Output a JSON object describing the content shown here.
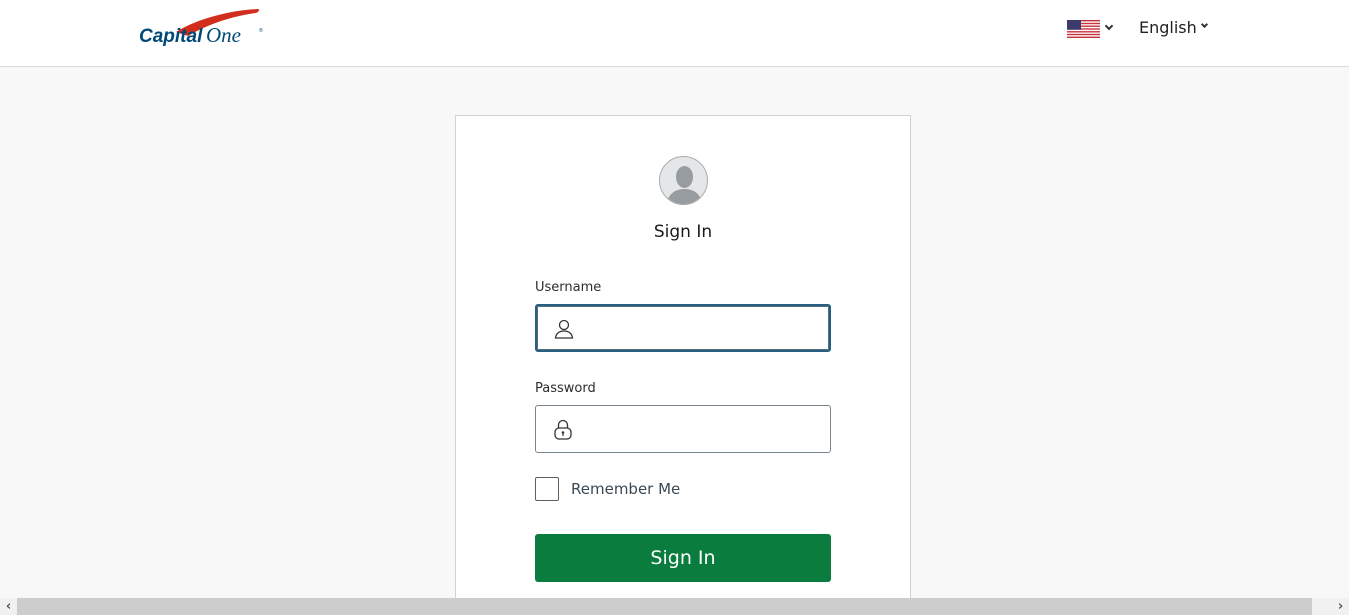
{
  "header": {
    "logo_text": "Capital One",
    "country_selector": {
      "selected": "United States",
      "icon": "us-flag-icon"
    },
    "language_selector": {
      "selected": "English"
    }
  },
  "signin_card": {
    "avatar_icon": "user-avatar-icon",
    "title": "Sign In",
    "username": {
      "label": "Username",
      "value": "",
      "placeholder": "",
      "icon": "user-icon"
    },
    "password": {
      "label": "Password",
      "value": "",
      "placeholder": "",
      "icon": "lock-icon"
    },
    "remember_me": {
      "label": "Remember Me",
      "checked": false
    },
    "submit_label": "Sign In"
  },
  "scrollbar": {
    "left_arrow": "‹",
    "right_arrow": "›"
  },
  "colors": {
    "primary_button": "#0a7c3e",
    "focus_border": "#255f82",
    "logo_red": "#d22e1e",
    "logo_navy": "#004977"
  }
}
